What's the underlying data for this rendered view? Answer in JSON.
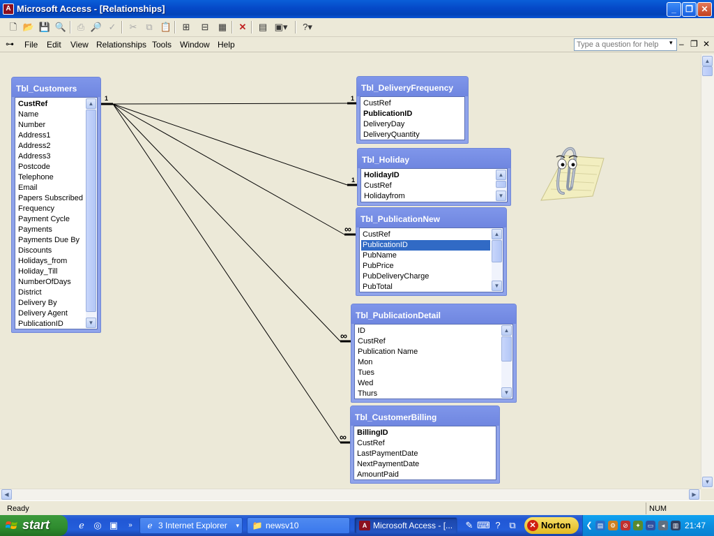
{
  "window": {
    "title": "Microsoft Access - [Relationships]"
  },
  "menubar": {
    "items": [
      "File",
      "Edit",
      "View",
      "Relationships",
      "Tools",
      "Window",
      "Help"
    ],
    "help_placeholder": "Type a question for help"
  },
  "tables": {
    "customers": {
      "name": "Tbl_Customers",
      "fields": [
        "CustRef",
        "Name",
        "Number",
        "Address1",
        "Address2",
        "Address3",
        "Postcode",
        "Telephone",
        "Email",
        "Papers Subscribed To",
        "Frequency",
        "Payment Cycle",
        "Payments",
        "Payments Due By",
        "Discounts",
        "Holidays_from",
        "Holiday_Till",
        "NumberOfDays",
        "District",
        "Delivery By",
        "Delivery Agent",
        "PublicationID"
      ]
    },
    "delivery_frequency": {
      "name": "Tbl_DeliveryFrequency",
      "fields": [
        "CustRef",
        "PublicationID",
        "DeliveryDay",
        "DeliveryQuantity"
      ]
    },
    "holiday": {
      "name": "Tbl_Holiday",
      "fields": [
        "HolidayID",
        "CustRef",
        "Holidayfrom"
      ]
    },
    "publication_new": {
      "name": "Tbl_PublicationNew",
      "fields": [
        "CustRef",
        "PublicationID",
        "PubName",
        "PubPrice",
        "PubDeliveryCharge",
        "PubTotal"
      ]
    },
    "publication_detail": {
      "name": "Tbl_PublicationDetail",
      "fields": [
        "ID",
        "CustRef",
        "Publication Name",
        "Mon",
        "Tues",
        "Wed",
        "Thurs"
      ]
    },
    "customer_billing": {
      "name": "Tbl_CustomerBilling",
      "fields": [
        "BillingID",
        "CustRef",
        "LastPaymentDate",
        "NextPaymentDate",
        "AmountPaid"
      ]
    }
  },
  "relationships": {
    "one_symbol": "1",
    "many_symbol": "∞"
  },
  "statusbar": {
    "status": "Ready",
    "num": "NUM"
  },
  "taskbar": {
    "start": "start",
    "tasks": [
      "3 Internet Explorer",
      "newsv10",
      "Microsoft Access - [..."
    ],
    "norton": "Norton",
    "clock": "21:47"
  },
  "colors": {
    "titlebar": "#0549c8",
    "table_header": "#7f96ea",
    "selection": "#316ac5",
    "taskbar": "#245edb",
    "start_button": "#2f8c2f"
  },
  "icons": {
    "toolbar": [
      "new-icon",
      "open-icon",
      "save-icon",
      "search-icon",
      "print-icon",
      "print-preview-icon",
      "spelling-icon",
      "cut-icon",
      "copy-icon",
      "paste-icon",
      "show-table-icon",
      "show-direct-icon",
      "show-all-icon",
      "delete-icon",
      "database-window-icon",
      "new-object-icon",
      "help-icon"
    ]
  }
}
